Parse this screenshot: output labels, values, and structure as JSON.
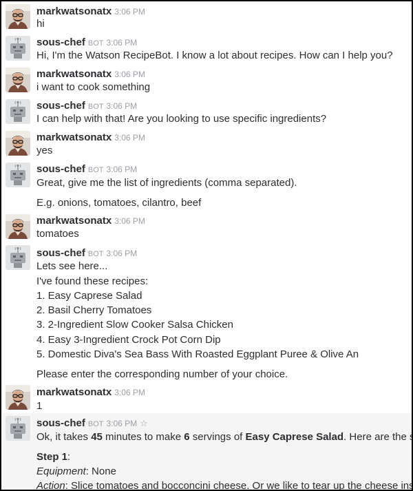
{
  "messages": [
    {
      "user": "markwatsonatx",
      "time": "3:06 PM",
      "lines": [
        "hi"
      ]
    },
    {
      "user": "sous-chef",
      "bot_tag": "BOT",
      "time": "3:06 PM",
      "lines": [
        "Hi, I'm the Watson RecipeBot. I know a lot about recipes. How can I help you?"
      ]
    },
    {
      "user": "markwatsonatx",
      "time": "3:06 PM",
      "lines": [
        "i want to cook something"
      ]
    },
    {
      "user": "sous-chef",
      "bot_tag": "BOT",
      "time": "3:06 PM",
      "lines": [
        "I can help with that! Are you looking to use specific ingredients?"
      ]
    },
    {
      "user": "markwatsonatx",
      "time": "3:06 PM",
      "lines": [
        "yes"
      ]
    },
    {
      "user": "sous-chef",
      "bot_tag": "BOT",
      "time": "3:06 PM",
      "lines": [
        "Great, give me the list of ingredients (comma separated).",
        "E.g. onions, tomatoes, cilantro, beef"
      ]
    },
    {
      "user": "markwatsonatx",
      "time": "3:06 PM",
      "lines": [
        "tomatoes"
      ]
    },
    {
      "user": "sous-chef",
      "bot_tag": "BOT",
      "time": "3:06 PM",
      "lines": [
        "Lets see here...",
        "I've found these recipes:",
        "1. Easy Caprese Salad",
        "2. Basil Cherry Tomatoes",
        "3. 2-Ingredient Slow Cooker Salsa Chicken",
        "4. Easy 3-Ingredient Crock Pot Corn Dip",
        "5. Domestic Diva's Sea Bass With Roasted Eggplant Puree & Olive An",
        "Please enter the corresponding number of your choice."
      ]
    },
    {
      "user": "markwatsonatx",
      "time": "3:06 PM",
      "lines": [
        "1"
      ]
    },
    {
      "user": "sous-chef",
      "bot_tag": "BOT",
      "time": "3:06 PM",
      "star_icon": "star-outline-icon",
      "summary": {
        "p1": "Ok, it takes ",
        "minutes": "45",
        "p2": " minutes to make ",
        "servings": "6",
        "p3": " servings of ",
        "recipe": "Easy Caprese Salad",
        "p4": ". Here are the steps:"
      },
      "step": {
        "label": "Step 1",
        "colon": ":"
      },
      "equipment": {
        "label": "Equipment",
        "value": ": None"
      },
      "action": {
        "label": "Action",
        "value": ": Slice tomatoes and bocconcini cheese. Or we like to tear up the cheese instead"
      }
    }
  ],
  "colors": {
    "text": "#2c2d30",
    "muted": "#9e9ea6",
    "highlight_bg": "#f5f5f5",
    "border": "#000000"
  }
}
